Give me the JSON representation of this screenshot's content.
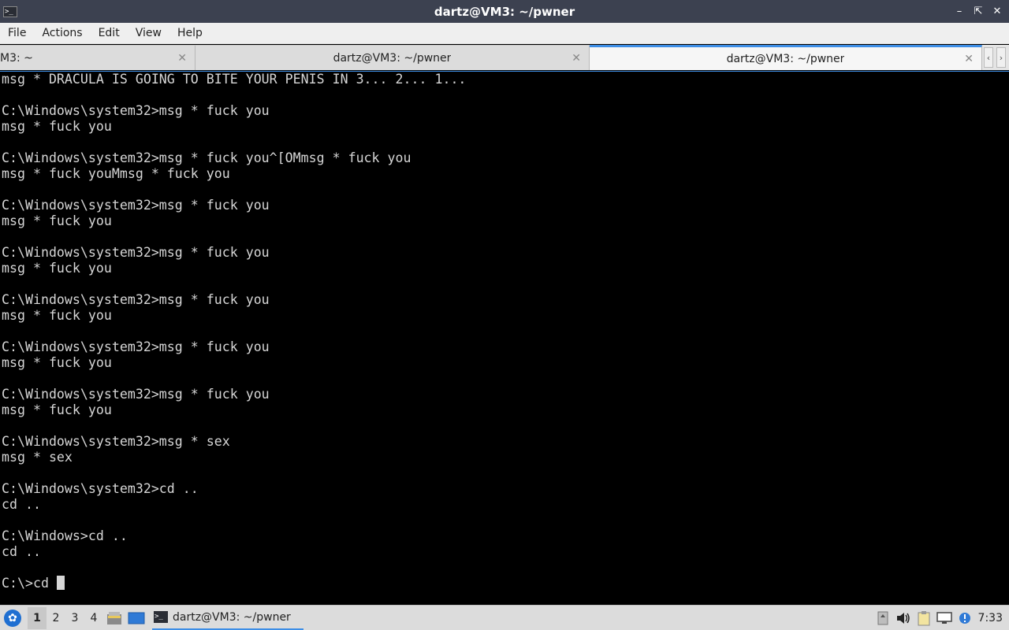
{
  "window": {
    "title": "dartz@VM3: ~/pwner",
    "icon": "terminal-icon",
    "controls": [
      "minimize-icon",
      "maximize-icon",
      "close-icon"
    ]
  },
  "menu": {
    "file": "File",
    "actions": "Actions",
    "edit": "Edit",
    "view": "View",
    "help": "Help"
  },
  "tabs": [
    {
      "label": "M3: ~"
    },
    {
      "label": "dartz@VM3: ~/pwner"
    },
    {
      "label": "dartz@VM3: ~/pwner"
    }
  ],
  "tab_close_glyph": "✕",
  "tab_scroll": {
    "left": "‹",
    "right": "›"
  },
  "terminal": {
    "lines": [
      "msg * DRACULA IS GOING TO BITE YOUR PENIS IN 3... 2... 1...",
      "",
      "C:\\Windows\\system32>msg * fuck you",
      "msg * fuck you",
      "",
      "C:\\Windows\\system32>msg * fuck you^[OMmsg * fuck you",
      "msg * fuck youMmsg * fuck you",
      "",
      "C:\\Windows\\system32>msg * fuck you",
      "msg * fuck you",
      "",
      "C:\\Windows\\system32>msg * fuck you",
      "msg * fuck you",
      "",
      "C:\\Windows\\system32>msg * fuck you",
      "msg * fuck you",
      "",
      "C:\\Windows\\system32>msg * fuck you",
      "msg * fuck you",
      "",
      "C:\\Windows\\system32>msg * fuck you",
      "msg * fuck you",
      "",
      "C:\\Windows\\system32>msg * sex",
      "msg * sex",
      "",
      "C:\\Windows\\system32>cd ..",
      "cd ..",
      "",
      "C:\\Windows>cd ..",
      "cd ..",
      ""
    ],
    "prompt_line": "C:\\>cd "
  },
  "taskbar": {
    "desktops": [
      "1",
      "2",
      "3",
      "4"
    ],
    "active_desktop": "1",
    "task_label": "dartz@VM3: ~/pwner",
    "clock": "7:33",
    "tray_icons": [
      "usb-icon",
      "volume-icon",
      "clipboard-icon",
      "network-icon",
      "notification-icon"
    ]
  }
}
